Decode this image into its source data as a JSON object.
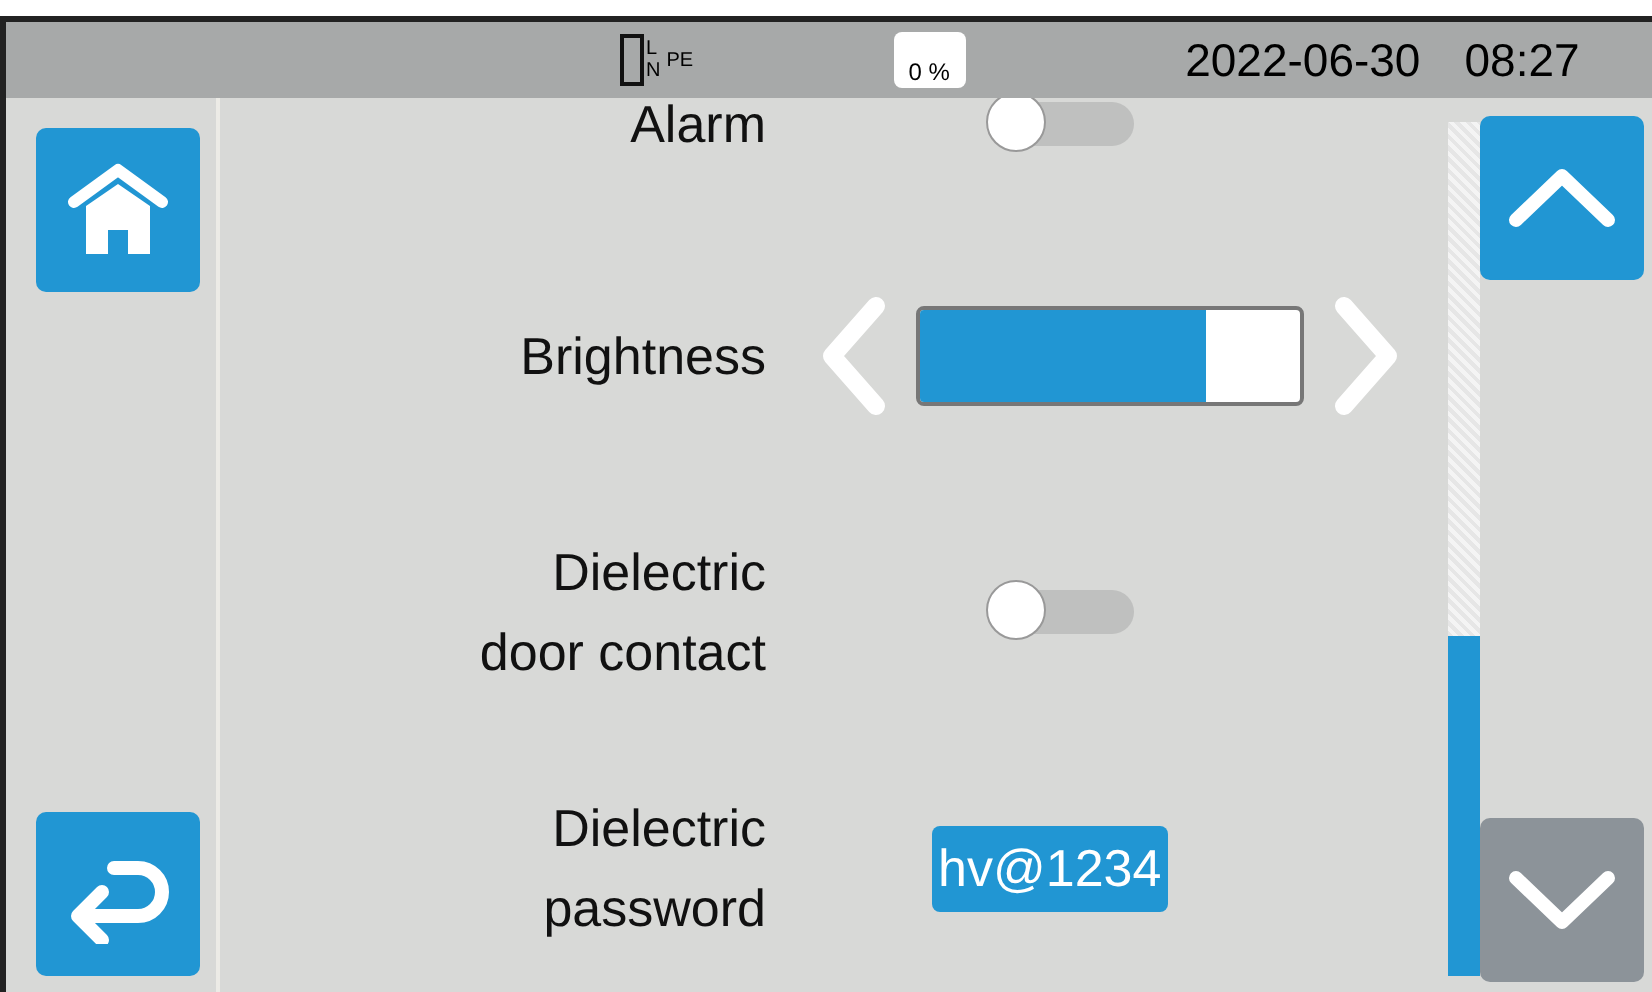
{
  "status_bar": {
    "plug": {
      "l": "L",
      "n": "N",
      "pe": "PE"
    },
    "storage": "0 %",
    "date": "2022-06-30",
    "time": "08:27"
  },
  "nav": {
    "up": {
      "disabled": false
    },
    "down": {
      "disabled": true
    }
  },
  "settings": [
    {
      "kind": "toggle",
      "label": "Alarm",
      "on": false
    },
    {
      "kind": "slider",
      "label": "Brightness",
      "level": 0.75
    },
    {
      "kind": "toggle",
      "label": "Dielectric\ndoor contact",
      "on": false
    },
    {
      "kind": "password",
      "label": "Dielectric\npassword",
      "value": "hv@1234"
    }
  ]
}
